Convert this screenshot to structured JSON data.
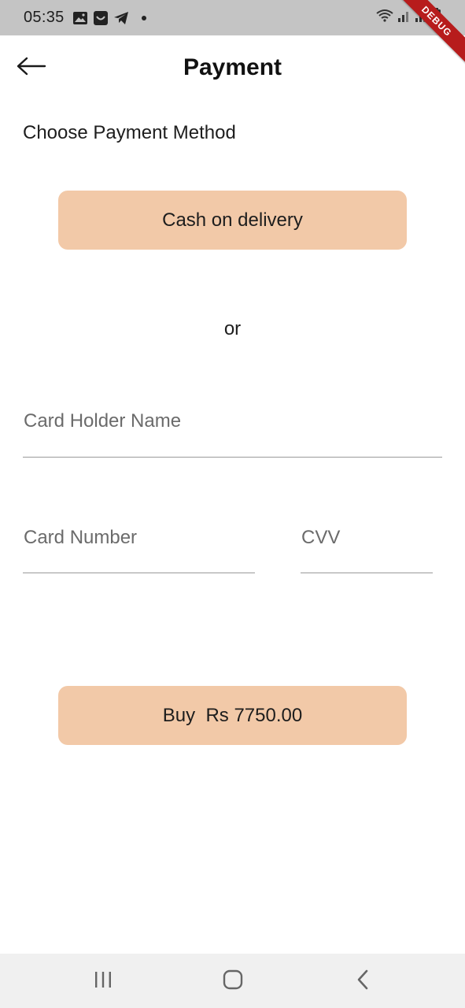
{
  "status_bar": {
    "time": "05:35",
    "debug_label": "DEBUG"
  },
  "app_bar": {
    "title": "Payment"
  },
  "payment": {
    "heading": "Choose Payment Method",
    "cod_label": "Cash on delivery",
    "or_label": "or",
    "card_holder_placeholder": "Card Holder Name",
    "card_number_placeholder": "Card Number",
    "cvv_placeholder": "CVV",
    "card_holder_value": "",
    "card_number_value": "",
    "cvv_value": "",
    "buy_label": "Buy  Rs 7750.00"
  },
  "colors": {
    "button_bg": "#f2c9a8",
    "status_bar_bg": "#c4c4c4",
    "nav_bar_bg": "#f0f0f0",
    "debug_ribbon": "#b71c1c"
  },
  "icons": {
    "back": "arrow-left-icon",
    "status_left": [
      "gallery-icon",
      "smile-app-icon",
      "telegram-icon",
      "notification-dot-icon"
    ],
    "status_right": [
      "wifi-icon",
      "signal-icon",
      "signal-icon",
      "battery-icon"
    ],
    "nav": [
      "recents-icon",
      "home-icon",
      "back-chevron-icon"
    ]
  }
}
